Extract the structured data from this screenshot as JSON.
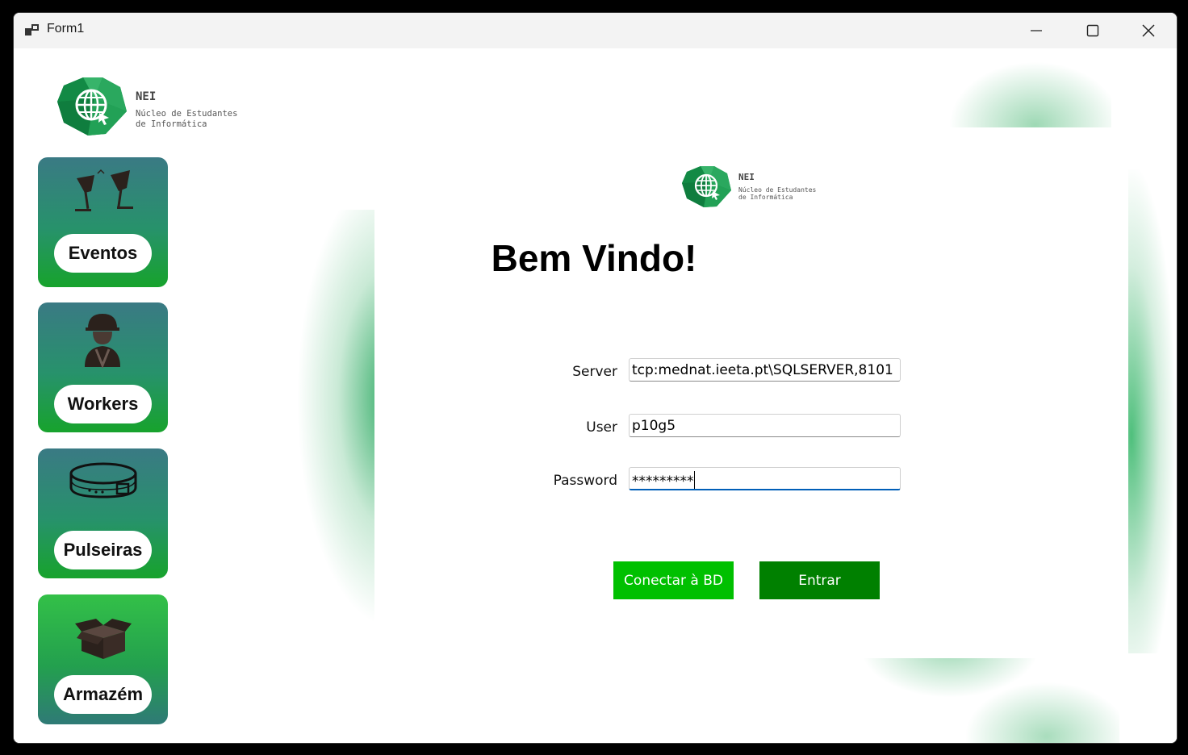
{
  "window": {
    "title": "Form1",
    "controls": {
      "minimize": "minimize",
      "maximize": "maximize",
      "close": "close"
    }
  },
  "brand": {
    "short": "NEI",
    "line1": "Núcleo de Estudantes",
    "line2": "de Informática"
  },
  "sidebar": {
    "items": [
      {
        "label": "Eventos",
        "icon": "toast-glasses-icon"
      },
      {
        "label": "Workers",
        "icon": "worker-icon"
      },
      {
        "label": "Pulseiras",
        "icon": "wristband-icon"
      },
      {
        "label": "Armazém",
        "icon": "box-icon"
      }
    ]
  },
  "login": {
    "heading": "Bem Vindo!",
    "server_label": "Server",
    "server_value": "tcp:mednat.ieeta.pt\\SQLSERVER,8101",
    "user_label": "User",
    "user_value": "p10g5",
    "password_label": "Password",
    "password_value": "*********",
    "connect_label": "Conectar à BD",
    "enter_label": "Entrar"
  },
  "colors": {
    "connect_button": "#00c000",
    "enter_button": "#008000",
    "card_top": "#3b7a82",
    "card_bottom": "#16a02e",
    "accent_green": "#1fa35a"
  }
}
